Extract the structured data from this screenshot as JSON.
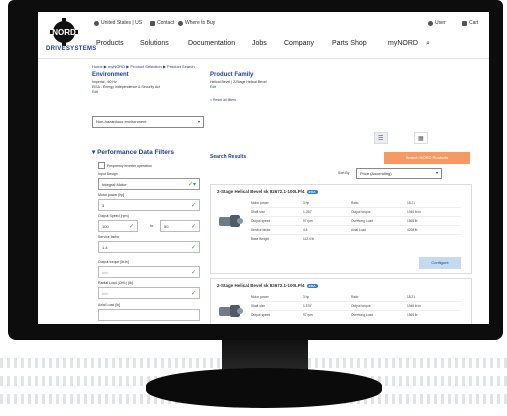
{
  "util": {
    "country": "United States | US",
    "contact": "Contact",
    "where_to_buy": "Where to Buy",
    "user": "User",
    "cart": "Cart"
  },
  "logo": {
    "brand": "NORD",
    "sub": "DRIVESYSTEMS"
  },
  "nav": [
    "Products",
    "Solutions",
    "Documentation",
    "Jobs",
    "Company",
    "Parts Shop",
    "myNORD"
  ],
  "breadcrumb": "Home  ▶  myNORD  ▶  Product Selection  ▶  Product Search",
  "environment": {
    "title": "Environment",
    "lines": [
      "Imperial - 60 Hz",
      "EISA - Energy Independence & Security Act",
      "Edit"
    ],
    "select": "Non-hazardous environment"
  },
  "product_family": {
    "title": "Product Family",
    "lines": [
      "Helical Bevel | 2-Stage Helical Bevel",
      "Edit"
    ],
    "reset": "< Reset all filters"
  },
  "filters": {
    "title": "Performance Data Filters",
    "checkbox": "Frequency inverter operation",
    "fields": [
      {
        "label": "Input Design",
        "value": "Integral Motor"
      },
      {
        "label": "Motor power [hp]",
        "value": "3"
      },
      {
        "label": "Output Speed [rpm]",
        "value": "100"
      },
      {
        "label": "Service factor",
        "value": "1.4"
      },
      {
        "label": "Output torque [lb-in]",
        "value": "min"
      },
      {
        "label": "Radial Load (OHL) [lb]",
        "value": "min"
      },
      {
        "label": "Axial Load [lb]",
        "value": ""
      }
    ],
    "speed_to": "to",
    "speed_max": "50"
  },
  "results": {
    "title": "Search Results",
    "button": "Search NORD Products",
    "sort_label": "Sort By",
    "sort_value": "Price (Ascending)",
    "cards": [
      {
        "title": "2-Stage Helical Bevel sk 92672.1-100LP/4",
        "badge": "EISA",
        "specs": [
          [
            "Motor power",
            "3 hp",
            "Ratio",
            "18.21"
          ],
          [
            "Shaft size",
            "1.250\"",
            "Output torque",
            "1946 lb-in"
          ],
          [
            "Output speed",
            "97 rpm",
            "Overhung Load",
            "1565 lb"
          ],
          [
            "Service factor",
            "4.6",
            "Axial Load",
            "4208 lb"
          ],
          [
            "Base Weight",
            "112.4 lb",
            "",
            ""
          ]
        ],
        "button": "Configure"
      },
      {
        "title": "2-Stage Helical Bevel sk 92672.1-100LP/4",
        "badge": "EISA",
        "specs": [
          [
            "Motor power",
            "3 hp",
            "Ratio",
            "18.21"
          ],
          [
            "Shaft size",
            "1.375\"",
            "Output torque",
            "1946 lb-in"
          ],
          [
            "Output speed",
            "97 rpm",
            "Overhung Load",
            "1565 lb"
          ]
        ],
        "button": "Configure"
      }
    ]
  },
  "colors": {
    "brand": "#1f3f8f",
    "accent": "#f49a63",
    "monitor": "#0d0d0d"
  }
}
